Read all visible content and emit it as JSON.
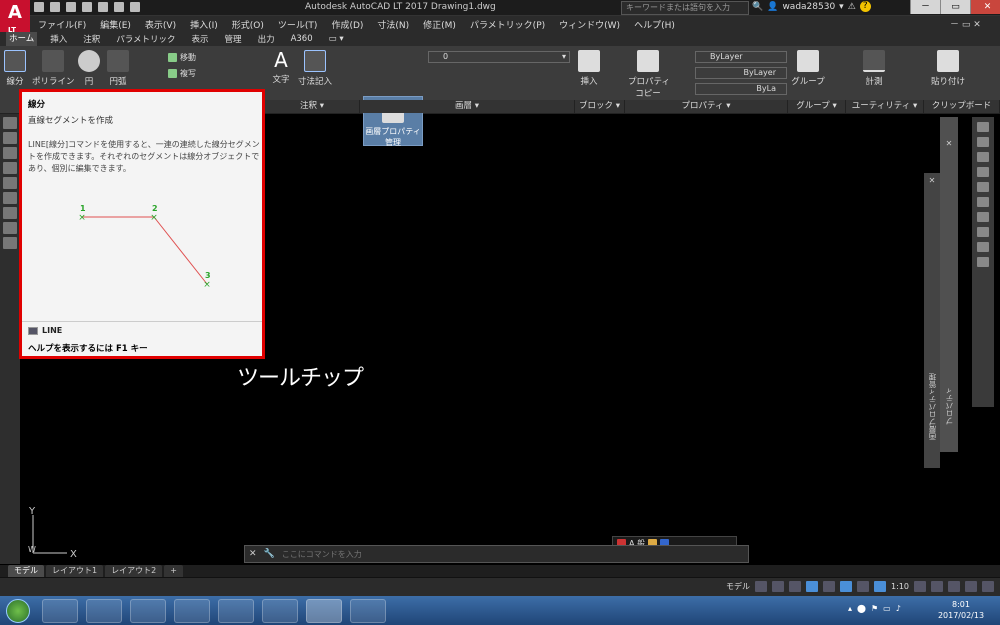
{
  "app": {
    "title": "Autodesk AutoCAD LT 2017    Drawing1.dwg",
    "logo": "A",
    "logo_sub": "LT",
    "search_placeholder": "キーワードまたは語句を入力",
    "username": "wada28530"
  },
  "window_controls": {
    "minimize": "－",
    "restore": "▭",
    "close": "✕"
  },
  "menu": [
    "ファイル(F)",
    "編集(E)",
    "表示(V)",
    "挿入(I)",
    "形式(O)",
    "ツール(T)",
    "作成(D)",
    "寸法(N)",
    "修正(M)",
    "パラメトリック(P)",
    "ウィンドウ(W)",
    "ヘルプ(H)"
  ],
  "doc_controls": "－ ▭ ✕",
  "ribbon_tabs": [
    "ホーム",
    "挿入",
    "注釈",
    "パラメトリック",
    "表示",
    "管理",
    "出力",
    "A360",
    "▭ ▾"
  ],
  "ribbon": {
    "draw": {
      "line": "線分",
      "polyline": "ポリライン",
      "circle": "円",
      "arc": "円弧"
    },
    "modify": {
      "move": "移動",
      "copy": "複写"
    },
    "annotation": {
      "text": "文字",
      "dimension": "寸法記入",
      "panel": "注釈 ▾"
    },
    "layers": {
      "layer_props": "画層プロパティ",
      "manage": "管理",
      "current_layer": "0",
      "panel": "画層 ▾"
    },
    "block": {
      "insert": "挿入",
      "panel": "ブロック ▾"
    },
    "properties": {
      "match": "プロパティ",
      "match2": "コピー",
      "color": "ByLayer",
      "linetype": "ByLayer",
      "lineweight": "ByLa",
      "panel": "プロパティ ▾"
    },
    "groups": {
      "group": "グループ",
      "panel": "グループ ▾"
    },
    "utilities": {
      "measure": "計測",
      "panel": "ユーティリティ ▾"
    },
    "clipboard": {
      "paste": "貼り付け",
      "panel": "クリップボード"
    }
  },
  "tooltip": {
    "title": "線分",
    "subtitle": "直線セグメントを作成",
    "description": "LINE[線分]コマンドを使用すると、一連の連続した線分セグメントを作成できます。それぞれのセグメントは線分オブジェクトであり、個別に編集できます。",
    "points": [
      {
        "label": "1"
      },
      {
        "label": "2"
      },
      {
        "label": "3"
      }
    ],
    "command": "LINE",
    "help": "ヘルプを表示するには F1 キー",
    "highlight_color": "#e00000",
    "point_color": "#2aa52a",
    "segment_color": "#e05050"
  },
  "annotation_label": "ツールチップ",
  "ucs": {
    "y": "Y",
    "x": "X",
    "w": "W"
  },
  "command_line": {
    "placeholder": "ここにコマンドを入力"
  },
  "command_toolbar": "A 般",
  "right_palettes": {
    "properties": "プロパティ",
    "layer_manager": "画層プロパティ管理"
  },
  "layout_tabs": [
    "モデル",
    "レイアウト1",
    "レイアウト2",
    "+"
  ],
  "status": {
    "model": "モデル",
    "scale": "1:10"
  },
  "taskbar": {
    "time": "8:01",
    "date": "2017/02/13"
  }
}
